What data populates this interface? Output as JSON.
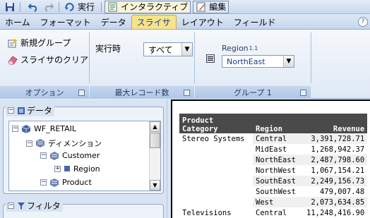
{
  "qat": {
    "run_label": "実行",
    "interactive_label": "インタラクティブ",
    "edit_label": "編集"
  },
  "tabs": [
    {
      "label": "ホーム"
    },
    {
      "label": "フォーマット"
    },
    {
      "label": "データ"
    },
    {
      "label": "スライサ"
    },
    {
      "label": "レイアウト"
    },
    {
      "label": "フィールド"
    }
  ],
  "active_tab": "スライサ",
  "ribbon": {
    "options": {
      "new_group": "新規グループ",
      "clear_slicer": "スライサのクリア",
      "footer": "オプション"
    },
    "max_records": {
      "run_label": "実行時",
      "value": "すべて",
      "footer": "最大レコード数"
    },
    "group": {
      "field_label": "Region",
      "superscript": "1.1",
      "value": "NorthEast",
      "footer": "グループ 1"
    }
  },
  "data_panel": {
    "title": "データ",
    "tree": [
      {
        "label": "WF_RETAIL",
        "expander": "⊟"
      },
      {
        "label": "ディメンション",
        "expander": "⊟"
      },
      {
        "label": "Customer",
        "expander": "⊟"
      },
      {
        "label": "Region",
        "expander": "⊞"
      },
      {
        "label": "Product",
        "expander": "⊟"
      }
    ]
  },
  "filter_panel": {
    "title": "フィルタ",
    "expander": "⊟"
  },
  "report": {
    "headers": {
      "category_line1": "Product",
      "category_line2": "Category",
      "region": "Region",
      "revenue": "Revenue"
    },
    "rows": [
      {
        "category": "Stereo Systems",
        "region": "Central",
        "revenue": "3,391,728.71"
      },
      {
        "category": "",
        "region": "MidEast",
        "revenue": "1,268,942.37"
      },
      {
        "category": "",
        "region": "NorthEast",
        "revenue": "2,487,798.60"
      },
      {
        "category": "",
        "region": "NorthWest",
        "revenue": "1,067,154.21"
      },
      {
        "category": "",
        "region": "SouthEast",
        "revenue": "2,249,156.73"
      },
      {
        "category": "",
        "region": "SouthWest",
        "revenue": "479,007.48"
      },
      {
        "category": "",
        "region": "West",
        "revenue": "2,073,634.85"
      },
      {
        "category": "Televisions",
        "region": "Central",
        "revenue": "11,248,416.90"
      }
    ]
  }
}
